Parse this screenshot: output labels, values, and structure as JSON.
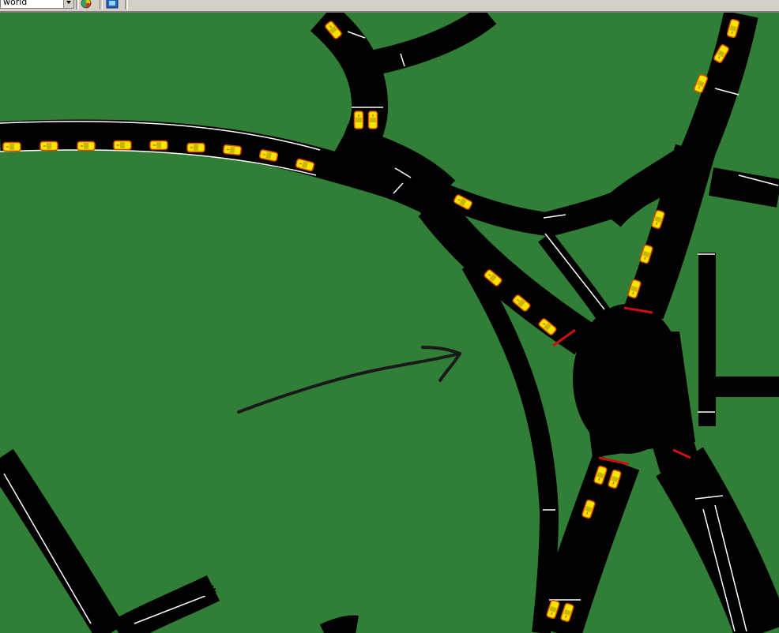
{
  "toolbar": {
    "world_select": {
      "value": "world"
    },
    "icons": [
      "color-wheel-icon",
      "map-view-icon"
    ]
  },
  "colors": {
    "grass": "#317f36",
    "road": "#000000",
    "lane_marking": "#ffffff",
    "car_body": "#f7e600",
    "car_outline": "#d84a00",
    "stop_line": "#cc1010",
    "toolbar": "#d4d0c8"
  },
  "annotation": {
    "type": "hand-drawn-arrow",
    "color": "#1a1a1a"
  }
}
